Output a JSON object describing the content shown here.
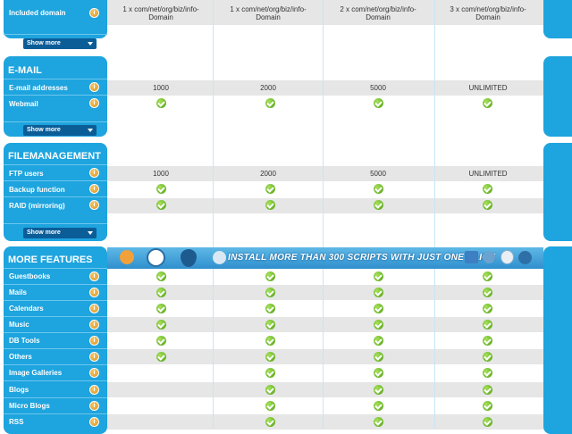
{
  "colors": {
    "panel_blue": "#1ea4de",
    "button_navy": "#0b5d98",
    "grey_row": "#e6e6e6",
    "check_green": "#4f9e14"
  },
  "domains": {
    "label": "Included domain",
    "values": [
      "1 x com/net/org/biz/info-\nDomain",
      "1 x com/net/org/biz/info-\nDomain",
      "2 x com/net/org/biz/info-\nDomain",
      "3 x com/net/org/biz/info-\nDomain"
    ],
    "v1a": "1 x com/net/org/biz/info-",
    "v1b": "Domain",
    "v2a": "1 x com/net/org/biz/info-",
    "v2b": "Domain",
    "v3a": "2 x com/net/org/biz/info-",
    "v3b": "Domain",
    "v4a": "3 x com/net/org/biz/info-",
    "v4b": "Domain"
  },
  "show_more": "Show more",
  "info_icon": "i",
  "email": {
    "title": "E-MAIL",
    "rows": [
      {
        "label": "E-mail addresses",
        "values": [
          "1000",
          "2000",
          "5000",
          "UNLIMITED"
        ]
      },
      {
        "label": "Webmail",
        "values": [
          "check",
          "check",
          "check",
          "check"
        ]
      }
    ]
  },
  "filemanagement": {
    "title": "FILEMANAGEMENT",
    "rows": [
      {
        "label": "FTP users",
        "values": [
          "1000",
          "2000",
          "5000",
          "UNLIMITED"
        ]
      },
      {
        "label": "Backup function",
        "values": [
          "check",
          "check",
          "check",
          "check"
        ]
      },
      {
        "label": "RAID (mirroring)",
        "values": [
          "check",
          "check",
          "check",
          "check"
        ]
      }
    ]
  },
  "more_features": {
    "title": "MORE FEATURES",
    "banner": "INSTALL MORE THAN 300 SCRIPTS WITH JUST ONE CLICK",
    "rows": [
      {
        "label": "Guestbooks",
        "values": [
          "check",
          "check",
          "check",
          "check"
        ]
      },
      {
        "label": "Mails",
        "values": [
          "check",
          "check",
          "check",
          "check"
        ]
      },
      {
        "label": "Calendars",
        "values": [
          "check",
          "check",
          "check",
          "check"
        ]
      },
      {
        "label": "Music",
        "values": [
          "check",
          "check",
          "check",
          "check"
        ]
      },
      {
        "label": "DB Tools",
        "values": [
          "check",
          "check",
          "check",
          "check"
        ]
      },
      {
        "label": "Others",
        "values": [
          "check",
          "check",
          "check",
          "check"
        ]
      },
      {
        "label": "Image Galleries",
        "values": [
          "",
          "check",
          "check",
          "check"
        ]
      },
      {
        "label": "Blogs",
        "values": [
          "",
          "check",
          "check",
          "check"
        ]
      },
      {
        "label": "Micro Blogs",
        "values": [
          "",
          "check",
          "check",
          "check"
        ]
      },
      {
        "label": "RSS",
        "values": [
          "",
          "check",
          "check",
          "check"
        ]
      }
    ]
  }
}
